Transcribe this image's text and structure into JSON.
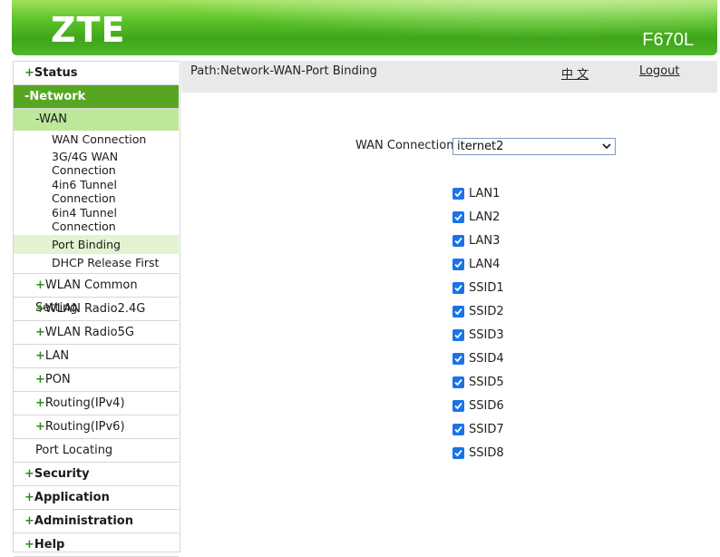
{
  "header": {
    "logo": "ZTE",
    "model": "F670L"
  },
  "sidebar": {
    "status": {
      "prefix": "+",
      "label": "Status"
    },
    "network": {
      "prefix": "-",
      "label": "Network"
    },
    "wan": {
      "prefix": "-",
      "label": "WAN"
    },
    "wan_items": [
      {
        "label": "WAN Connection"
      },
      {
        "label": "3G/4G WAN Connection"
      },
      {
        "label": "4in6 Tunnel Connection"
      },
      {
        "label": "6in4 Tunnel Connection"
      },
      {
        "label": "Port Binding"
      },
      {
        "label": "DHCP Release First"
      }
    ],
    "sections": [
      {
        "prefix": "+",
        "label": "WLAN Common Setting"
      },
      {
        "prefix": "+",
        "label": "WLAN Radio2.4G"
      },
      {
        "prefix": "+",
        "label": "WLAN Radio5G"
      },
      {
        "prefix": "+",
        "label": "LAN"
      },
      {
        "prefix": "+",
        "label": "PON"
      },
      {
        "prefix": "+",
        "label": "Routing(IPv4)"
      },
      {
        "prefix": "+",
        "label": "Routing(IPv6)"
      },
      {
        "prefix": "",
        "label": "Port Locating"
      }
    ],
    "bottom": [
      {
        "prefix": "+",
        "label": "Security"
      },
      {
        "prefix": "+",
        "label": "Application"
      },
      {
        "prefix": "+",
        "label": "Administration"
      },
      {
        "prefix": "+",
        "label": "Help"
      }
    ]
  },
  "pathbar": {
    "path": "Path:Network-WAN-Port Binding",
    "lang": "中 文",
    "logout": "Logout"
  },
  "form": {
    "wan_label": "WAN Connection",
    "wan_value": "iternet2",
    "ports": [
      {
        "label": "LAN1",
        "checked": true
      },
      {
        "label": "LAN2",
        "checked": true
      },
      {
        "label": "LAN3",
        "checked": true
      },
      {
        "label": "LAN4",
        "checked": true
      },
      {
        "label": "SSID1",
        "checked": true
      },
      {
        "label": "SSID2",
        "checked": true
      },
      {
        "label": "SSID3",
        "checked": true
      },
      {
        "label": "SSID4",
        "checked": true
      },
      {
        "label": "SSID5",
        "checked": true
      },
      {
        "label": "SSID6",
        "checked": true
      },
      {
        "label": "SSID7",
        "checked": true
      },
      {
        "label": "SSID8",
        "checked": true
      }
    ]
  },
  "colors": {
    "brand_green": "#56a622",
    "wan_highlight": "#bde79b",
    "checkbox": "#1a73e8"
  }
}
